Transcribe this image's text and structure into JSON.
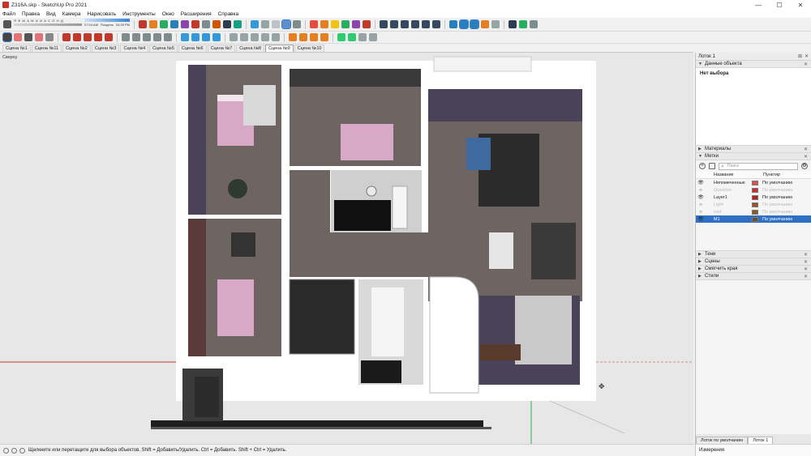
{
  "window": {
    "title": "Z316А.skp - SketchUp Pro 2021",
    "controls": [
      "—",
      "☐",
      "✕"
    ]
  },
  "menu": [
    "Файл",
    "Правка",
    "Вид",
    "Камера",
    "Нарисовать",
    "Инструменты",
    "Окно",
    "Расширения",
    "Справка"
  ],
  "shadow_widget": {
    "letters": "Я Ф М А М И И А С О Н Д",
    "time_start": "07:04 AM",
    "time_mid": "Полдень",
    "time_end": "04:39 PM"
  },
  "scenes": [
    "Сцена №1",
    "Сцена №11",
    "Сцена №2",
    "Сцена №3",
    "Сцена №4",
    "Сцена №5",
    "Сцена №6",
    "Сцена №7",
    "Сцена №8",
    "Сцена №9",
    "Сцена №10"
  ],
  "active_scene": "Сцена №9",
  "viewport": {
    "label": "Сверху"
  },
  "tray": {
    "title": "Лоток 1",
    "entity_info": {
      "header": "Данные объекта",
      "value": "Нет выбора"
    },
    "materials": "Материалы",
    "tags": {
      "header": "Метки",
      "search_placeholder": "Поиск",
      "col_name": "Название",
      "col_dash": "Пунктир",
      "rows": [
        {
          "name": "Непомеченные",
          "dash": "По умолчанию",
          "color": "#d9534f",
          "state": "normal",
          "visible": "👁"
        },
        {
          "name": "Question",
          "dash": "По умолчанию",
          "color": "#c9302c",
          "state": "dim",
          "visible": "○"
        },
        {
          "name": "Layer1",
          "dash": "По умолчанию",
          "color": "#b22222",
          "state": "normal",
          "visible": "👁"
        },
        {
          "name": "Light",
          "dash": "По умолчанию",
          "color": "#a0522d",
          "state": "dim",
          "visible": "○"
        },
        {
          "name": "roof",
          "dash": "По умолчанию",
          "color": "#8b5a2b",
          "state": "dim",
          "visible": "○"
        },
        {
          "name": "M1",
          "dash": "По умолчанию",
          "color": "#6b4e2e",
          "state": "sel",
          "visible": "👁"
        }
      ]
    },
    "collapsed_panels": [
      "Тени",
      "Сцены",
      "Смягчить края",
      "Стили"
    ],
    "tabs": [
      "Лоток по умолчанию",
      "Лоток 1"
    ],
    "active_tab": "Лоток 1"
  },
  "status": {
    "message": "Щелкните или перетащите для выбора объектов. Shift = Добавить/Удалить. Ctrl = Добавить. Shift + Ctrl = Удалить.",
    "measure_label": "Измерения"
  },
  "colors": {
    "accent": "#2f6fc4",
    "axis_red": "#c0392b",
    "axis_green": "#27ae60",
    "floor_wood": "#6e6462",
    "wall_purple": "#4a4258",
    "bed_pink": "#d8a9c6"
  }
}
